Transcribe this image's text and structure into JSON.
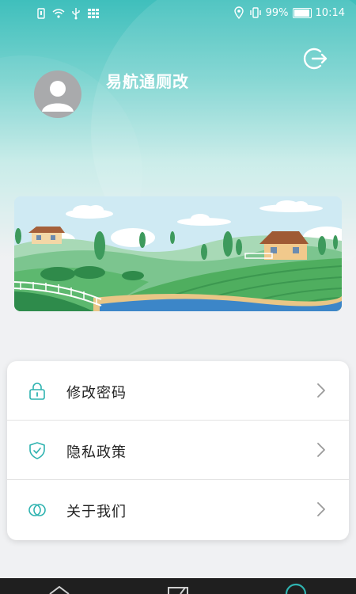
{
  "status_bar": {
    "battery_percent": "99%",
    "time": "10:14"
  },
  "profile": {
    "username": "易航通厕改"
  },
  "menu": {
    "items": [
      {
        "label": "修改密码",
        "icon": "lock-icon"
      },
      {
        "label": "隐私政策",
        "icon": "shield-check-icon"
      },
      {
        "label": "关于我们",
        "icon": "about-circles-icon"
      }
    ]
  },
  "colors": {
    "accent": "#2fb3b0",
    "header_gradient_top": "#3fbfbc",
    "background": "#f0f1f3"
  }
}
